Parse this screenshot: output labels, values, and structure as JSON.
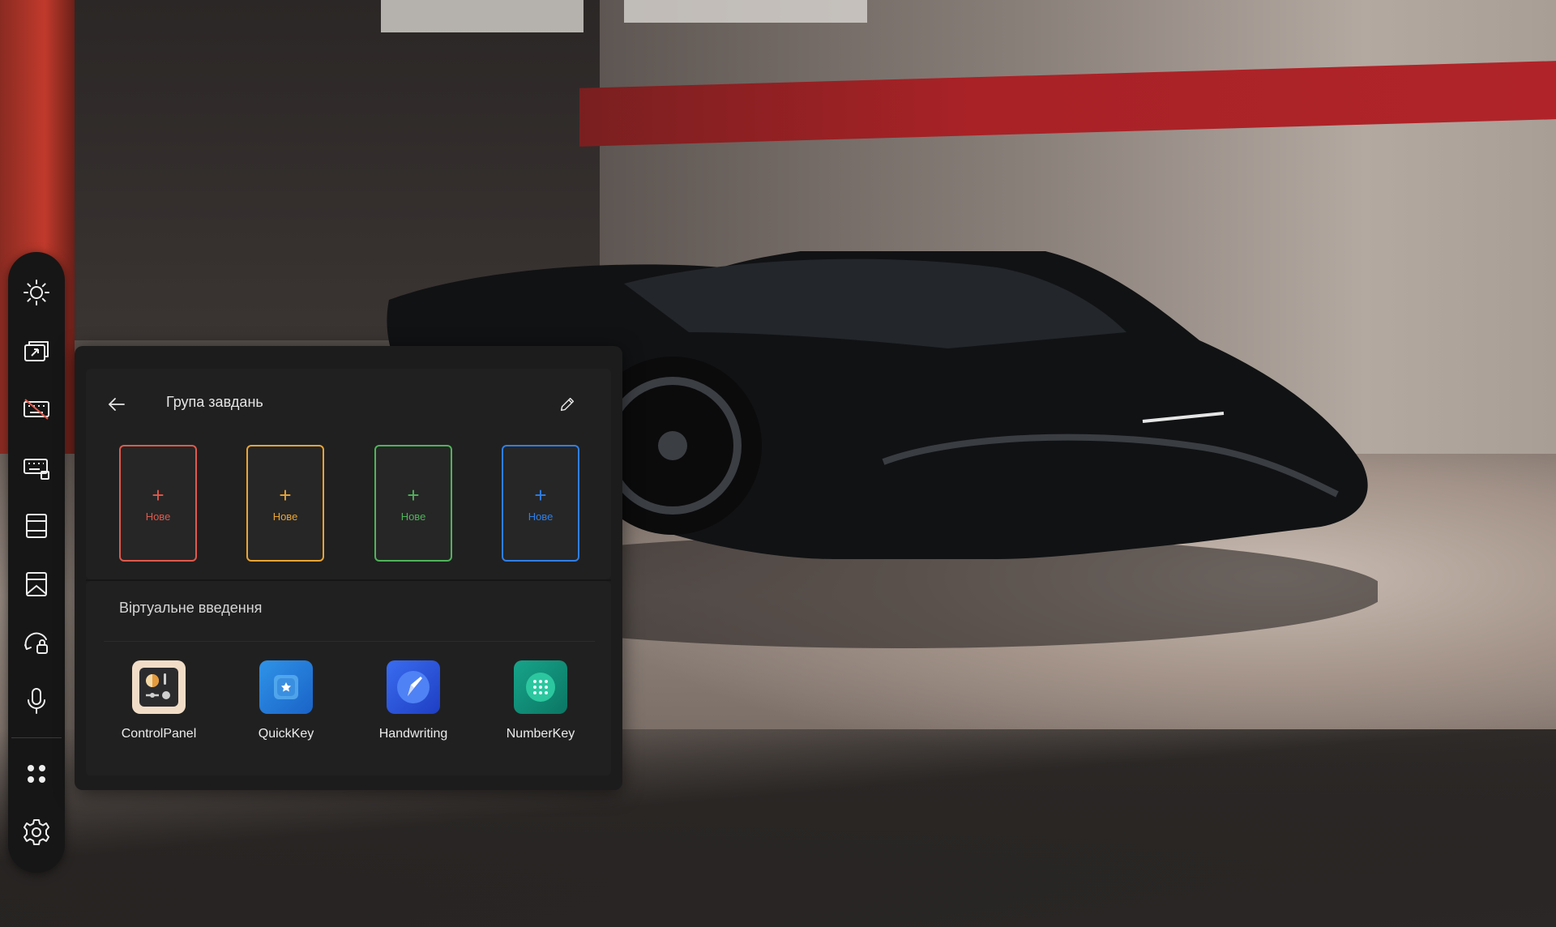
{
  "task_panel": {
    "title": "Група завдань",
    "new_slots": [
      {
        "label": "Нове",
        "plus": "+",
        "color": "#e0594c"
      },
      {
        "label": "Нове",
        "plus": "+",
        "color": "#e9a534"
      },
      {
        "label": "Нове",
        "plus": "+",
        "color": "#4fb35a"
      },
      {
        "label": "Нове",
        "plus": "+",
        "color": "#2f7fe6"
      }
    ],
    "section_title": "Віртуальне введення",
    "apps": [
      {
        "name": "ControlPanel",
        "icon": "control-panel-icon"
      },
      {
        "name": "QuickKey",
        "icon": "quickkey-icon"
      },
      {
        "name": "Handwriting",
        "icon": "handwriting-icon"
      },
      {
        "name": "NumberKey",
        "icon": "numberkey-icon"
      }
    ]
  },
  "side_toolbar": {
    "items": [
      {
        "icon": "brightness-icon"
      },
      {
        "icon": "window-switch-icon"
      },
      {
        "icon": "keyboard-disabled-icon"
      },
      {
        "icon": "keyboard-settings-icon"
      },
      {
        "icon": "split-screen-icon"
      },
      {
        "icon": "screen-adjust-icon"
      },
      {
        "icon": "rotate-lock-icon"
      },
      {
        "icon": "microphone-icon"
      },
      {
        "icon": "apps-grid-icon"
      },
      {
        "icon": "settings-gear-icon"
      }
    ]
  },
  "colors": {
    "panel_bg": "#1c1c1c",
    "toolbar_bg": "#161616",
    "accent_red": "#e0594c",
    "accent_orange": "#e9a534",
    "accent_green": "#4fb35a",
    "accent_blue": "#2f7fe6"
  }
}
